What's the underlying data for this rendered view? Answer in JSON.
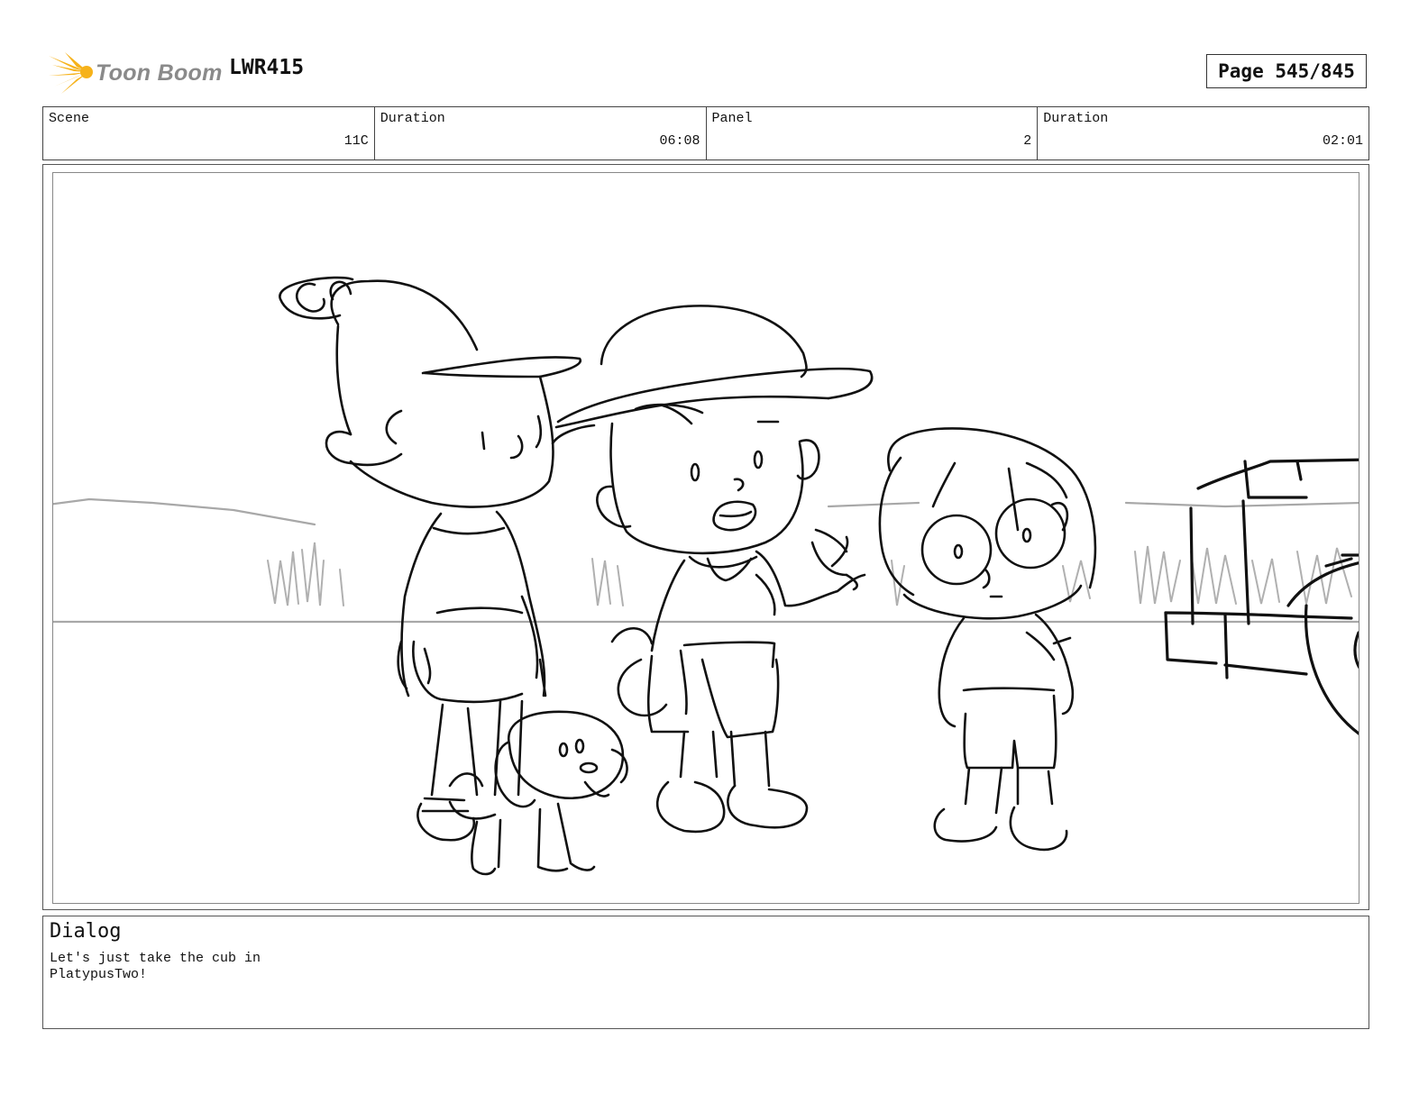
{
  "header": {
    "logo_text": "Toon Boom",
    "logo_icon": "sunburst-logo-icon",
    "project_code": "LWR415",
    "page_label": "Page 545/845"
  },
  "info": {
    "scene": {
      "label": "Scene",
      "value": "11C"
    },
    "duration": {
      "label": "Duration",
      "value": "06:08"
    },
    "panel": {
      "label": "Panel",
      "value": "2"
    },
    "panel_duration": {
      "label": "Duration",
      "value": "02:01"
    }
  },
  "dialog": {
    "title": "Dialog",
    "text": "Let's just take the cub in\nPlatypusTwo!"
  },
  "colors": {
    "logo_orange": "#f6b21a",
    "logo_gray": "#8a8a8a",
    "sketch_line": "#111111",
    "background_line": "#a8a8a8"
  }
}
